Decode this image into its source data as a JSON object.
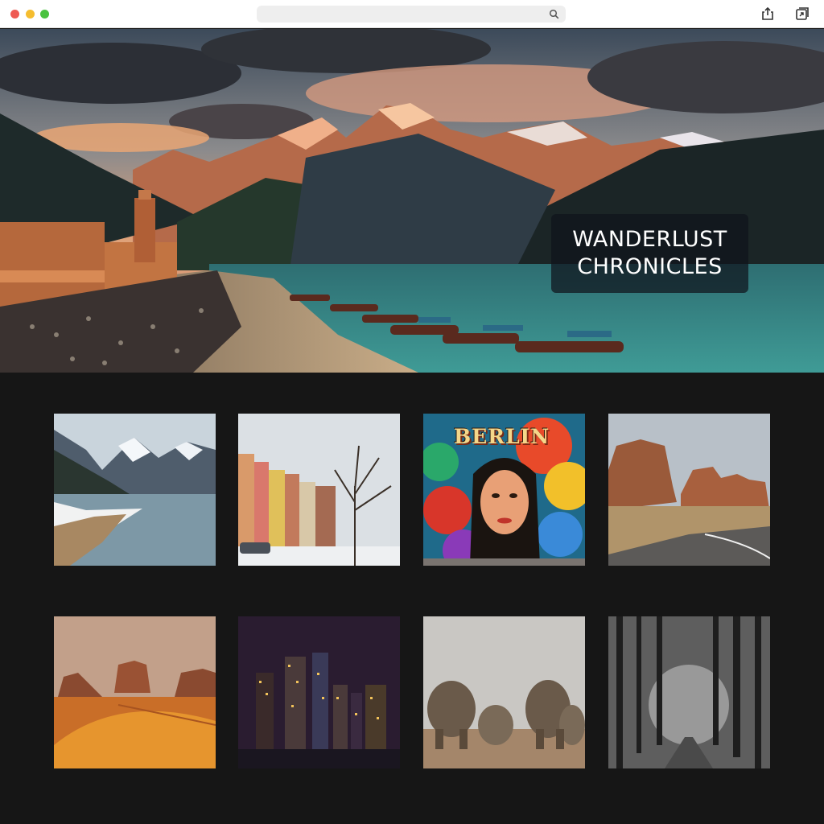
{
  "window": {
    "controls": [
      "close",
      "minimize",
      "maximize"
    ],
    "address_bar": {
      "value": "",
      "icon": "search-icon"
    },
    "toolbar": {
      "icons": [
        "share-icon",
        "tabs-icon"
      ]
    }
  },
  "hero": {
    "title_line1": "WANDERLUST",
    "title_line2": "CHRONICLES"
  },
  "gallery": {
    "tiles": [
      {
        "name": "snowy-lake-mountains"
      },
      {
        "name": "winter-city-street"
      },
      {
        "name": "berlin-mural",
        "label": "BERLIN"
      },
      {
        "name": "desert-rock-road"
      },
      {
        "name": "sand-dunes-mesas"
      },
      {
        "name": "night-skyline"
      },
      {
        "name": "elephant-herd"
      },
      {
        "name": "foggy-forest-path"
      }
    ]
  },
  "colors": {
    "page_bg": "#161616",
    "chrome_bg": "#ffffff",
    "title_text": "#ffffff"
  }
}
